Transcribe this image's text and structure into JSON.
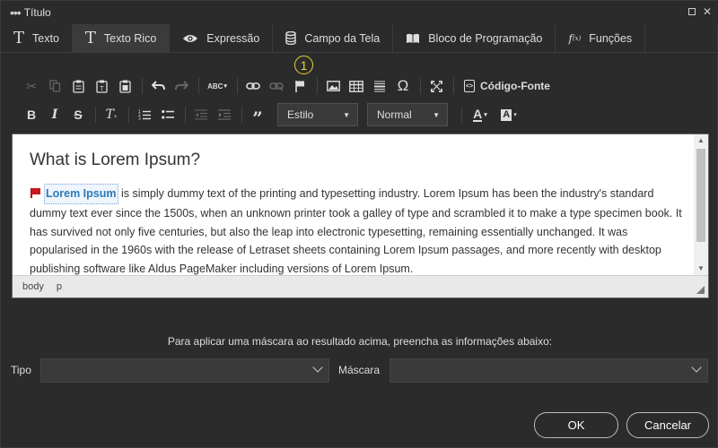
{
  "window": {
    "dots": "•••",
    "title": "Título"
  },
  "tabs": [
    {
      "label": "Texto",
      "icon": "text-t-icon"
    },
    {
      "label": "Texto Rico",
      "icon": "text-t-icon",
      "active": true
    },
    {
      "label": "Expressão",
      "icon": "eye-icon"
    },
    {
      "label": "Campo da Tela",
      "icon": "database-icon"
    },
    {
      "label": "Bloco de Programação",
      "icon": "book-icon"
    },
    {
      "label": "Funções",
      "icon": "function-icon"
    }
  ],
  "marker": "1",
  "toolbar": {
    "source_label": "Código-Fonte",
    "style_combo": "Estilo",
    "format_combo": "Normal"
  },
  "editor": {
    "heading": "What is Lorem Ipsum?",
    "anchor_text": "Lorem Ipsum",
    "paragraph_rest": " is simply dummy text of the printing and typesetting industry. Lorem Ipsum has been the industry's standard dummy text ever since the 1500s, when an unknown printer took a galley of type and scrambled it to make a type specimen book. It has survived not only five centuries, but also the leap into electronic typesetting, remaining essentially unchanged. It was popularised in the 1960s with the release of Letraset sheets containing Lorem Ipsum passages, and more recently with desktop publishing software like Aldus PageMaker including versions of Lorem Ipsum.",
    "path": [
      "body",
      "p"
    ]
  },
  "mask": {
    "hint": "Para aplicar uma máscara ao resultado acima, preencha as informações abaixo:",
    "tipo_label": "Tipo",
    "tipo_value": "",
    "mascara_label": "Máscara",
    "mascara_value": ""
  },
  "buttons": {
    "ok": "OK",
    "cancel": "Cancelar"
  },
  "colors": {
    "accent_marker": "#e8d23c",
    "link": "#2a7ab8",
    "flag": "#c8191f"
  }
}
